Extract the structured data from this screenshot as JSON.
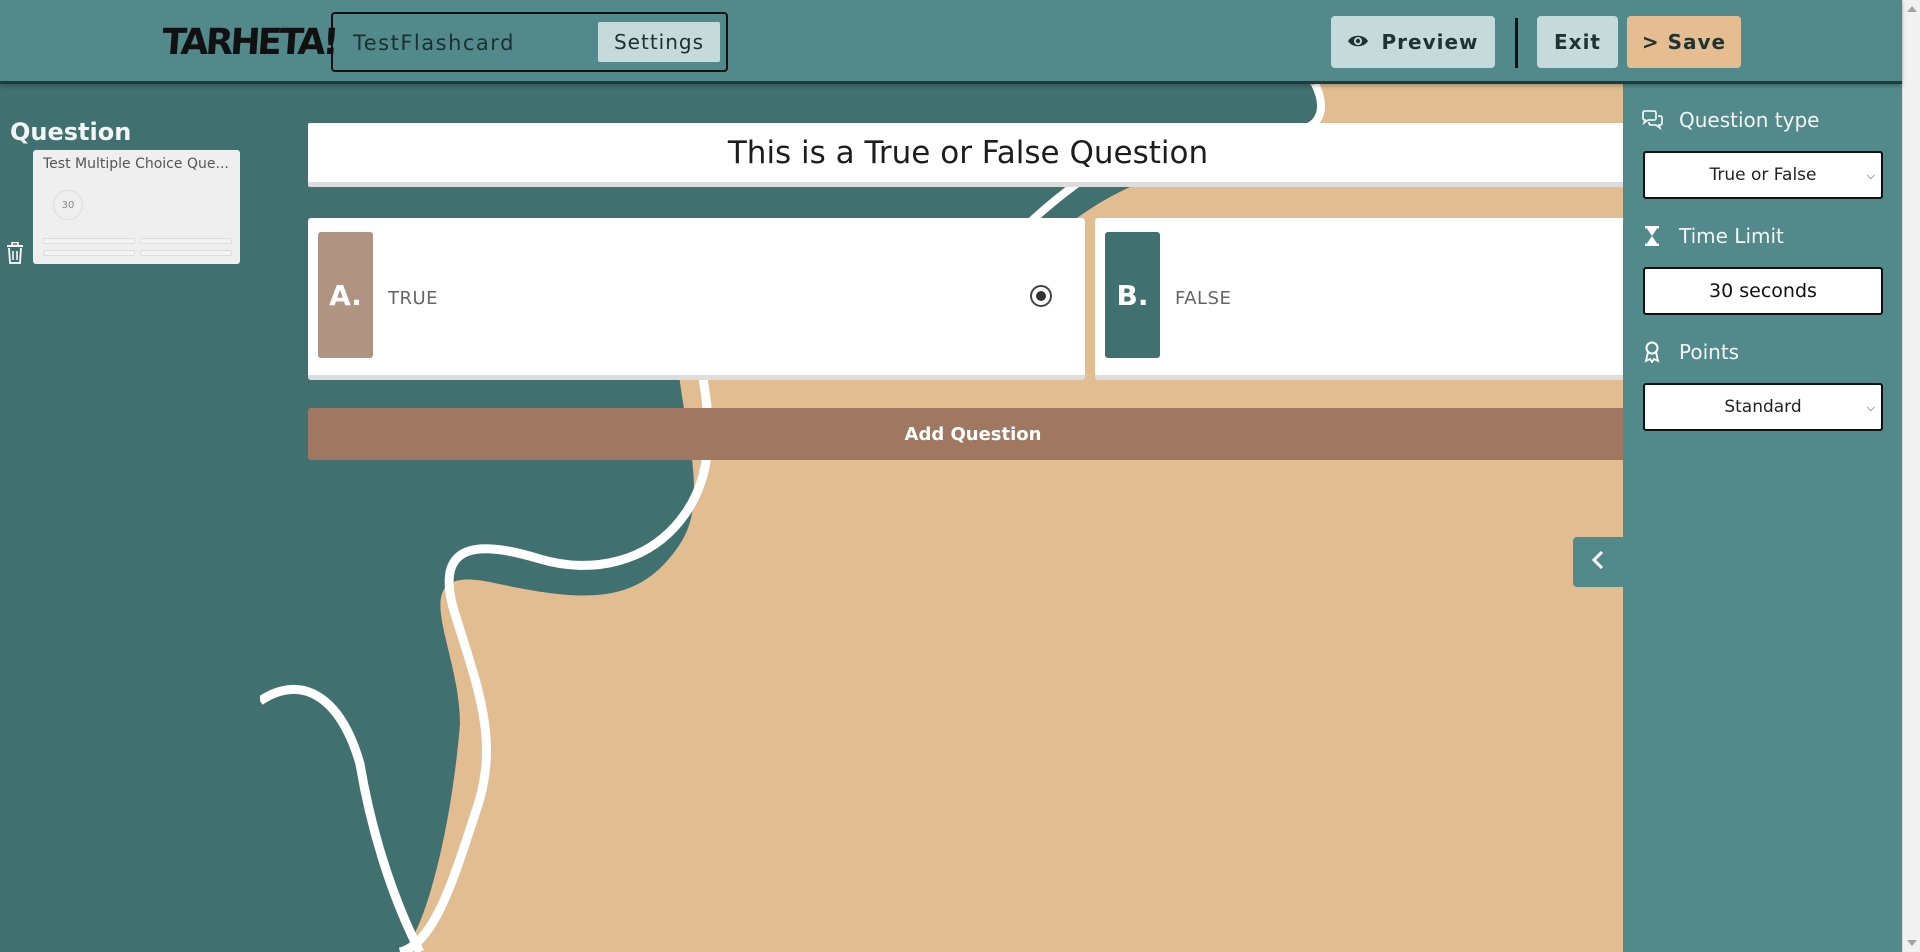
{
  "header": {
    "logo_text": "TARHETA!",
    "title_value": "TestFlashcard",
    "settings_label": "Settings",
    "preview_label": "Preview",
    "exit_label": "Exit",
    "save_label": "> Save"
  },
  "sidebar": {
    "heading": "Question",
    "slides": [
      {
        "title": "Test Multiple Choice Que...",
        "timer": "30"
      }
    ],
    "delete_icon": "trash-icon"
  },
  "editor": {
    "question_text": "This is a True or False Question",
    "answers": [
      {
        "letter": "A.",
        "text": "TRUE",
        "correct": true
      },
      {
        "letter": "B.",
        "text": "FALSE",
        "correct": false
      }
    ],
    "add_question_label": "Add Question",
    "collapse_icon": "chevron-left-icon"
  },
  "settings_panel": {
    "question_type_label": "Question type",
    "question_type_value": "True or False",
    "time_limit_label": "Time Limit",
    "time_limit_value": "30 seconds",
    "points_label": "Points",
    "points_value": "Standard"
  },
  "colors": {
    "topbar": "#528a8b",
    "sidebar": "#417070",
    "canvas": "#e2bd91",
    "save_button": "#e5bd91",
    "add_question": "#a07861",
    "badge_a": "#b09381",
    "badge_b": "#417070"
  }
}
